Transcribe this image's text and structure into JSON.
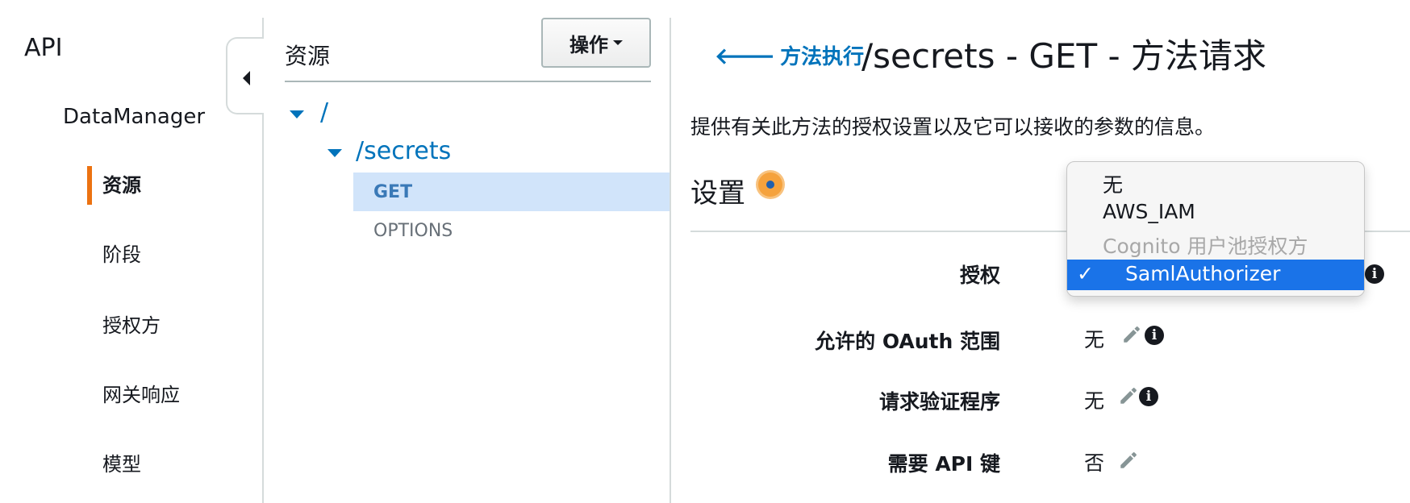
{
  "nav": {
    "api_label": "API",
    "api_name": "DataManager",
    "items": [
      {
        "label": "资源",
        "active": true
      },
      {
        "label": "阶段",
        "active": false
      },
      {
        "label": "授权方",
        "active": false
      },
      {
        "label": "网关响应",
        "active": false
      },
      {
        "label": "模型",
        "active": false
      }
    ]
  },
  "resources": {
    "title": "资源",
    "actions_label": "操作",
    "tree": {
      "root": "/",
      "child": "/secrets",
      "methods": [
        "GET",
        "OPTIONS"
      ],
      "selected_method": "GET"
    }
  },
  "main": {
    "back_label": "方法执行",
    "title": "/secrets - GET - 方法请求",
    "description": "提供有关此方法的授权设置以及它可以接收的参数的信息。",
    "settings_title": "设置",
    "rows": {
      "authorization": {
        "label": "授权"
      },
      "oauth": {
        "label": "允许的 OAuth 范围",
        "value": "无"
      },
      "validator": {
        "label": "请求验证程序",
        "value": "无"
      },
      "api_key": {
        "label": "需要 API 键",
        "value": "否"
      }
    },
    "authorization_dropdown": {
      "options": [
        {
          "label": "无",
          "disabled": false,
          "selected": false
        },
        {
          "label": "AWS_IAM",
          "disabled": false,
          "selected": false
        },
        {
          "label": "Cognito 用户池授权方",
          "disabled": true,
          "selected": false
        },
        {
          "label": "SamlAuthorizer",
          "disabled": false,
          "selected": true
        }
      ],
      "check_mark": "✓"
    }
  },
  "colors": {
    "accent": "#ec7211",
    "link": "#0073bb",
    "selection": "#1a73e8",
    "tree_selected_bg": "#d1e4fa"
  }
}
